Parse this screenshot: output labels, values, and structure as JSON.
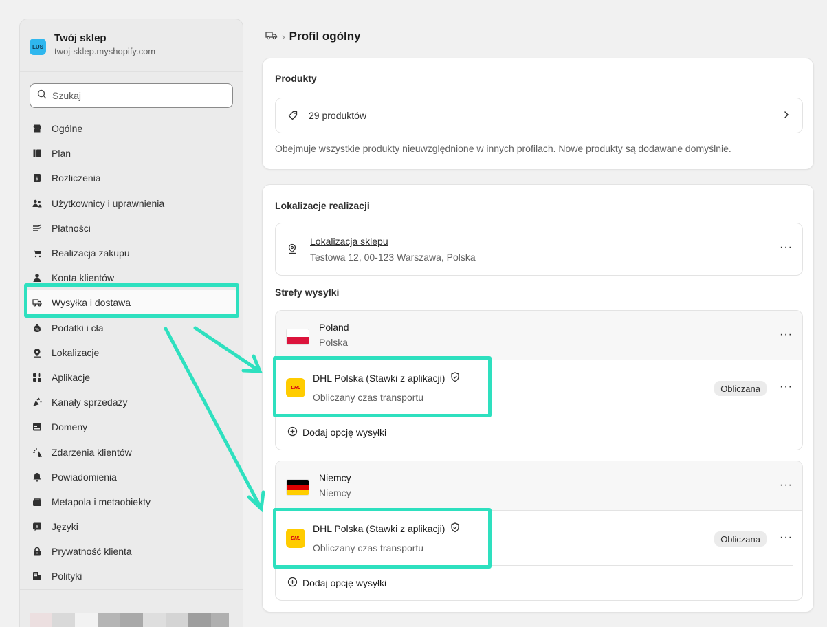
{
  "store": {
    "avatar": "LUS",
    "name": "Twój sklep",
    "url": "twoj-sklep.myshopify.com"
  },
  "search": {
    "placeholder": "Szukaj"
  },
  "nav": [
    {
      "label": "Ogólne",
      "icon": "store-icon"
    },
    {
      "label": "Plan",
      "icon": "plan-icon"
    },
    {
      "label": "Rozliczenia",
      "icon": "billing-icon"
    },
    {
      "label": "Użytkownicy i uprawnienia",
      "icon": "users-icon"
    },
    {
      "label": "Płatności",
      "icon": "payments-icon"
    },
    {
      "label": "Realizacja zakupu",
      "icon": "cart-icon"
    },
    {
      "label": "Konta klientów",
      "icon": "person-icon"
    },
    {
      "label": "Wysyłka i dostawa",
      "icon": "truck-icon",
      "active": true
    },
    {
      "label": "Podatki i cła",
      "icon": "tax-icon"
    },
    {
      "label": "Lokalizacje",
      "icon": "location-icon"
    },
    {
      "label": "Aplikacje",
      "icon": "apps-icon"
    },
    {
      "label": "Kanały sprzedaży",
      "icon": "channels-icon"
    },
    {
      "label": "Domeny",
      "icon": "domains-icon"
    },
    {
      "label": "Zdarzenia klientów",
      "icon": "events-icon"
    },
    {
      "label": "Powiadomienia",
      "icon": "bell-icon"
    },
    {
      "label": "Metapola i metaobiekty",
      "icon": "metafields-icon"
    },
    {
      "label": "Języki",
      "icon": "languages-icon"
    },
    {
      "label": "Prywatność klienta",
      "icon": "lock-icon"
    },
    {
      "label": "Polityki",
      "icon": "policies-icon"
    }
  ],
  "breadcrumb": {
    "separator": "›",
    "title": "Profil ogólny"
  },
  "products": {
    "title": "Produkty",
    "count_label": "29 produktów",
    "description": "Obejmuje wszystkie produkty nieuwzględnione w innych profilach. Nowe produkty są dodawane domyślnie."
  },
  "fulfillment": {
    "title": "Lokalizacje realizacji",
    "location_name": "Lokalizacja sklepu",
    "location_address": "Testowa 12, 00-123 Warszawa, Polska",
    "zones_title": "Strefy wysyłki"
  },
  "zones": [
    {
      "name": "Poland",
      "subtitle": "Polska",
      "flag_colors": [
        "#ffffff",
        "#dc143c"
      ],
      "rate_name": "DHL Polska (Stawki z aplikacji)",
      "rate_sub": "Obliczany czas transportu",
      "badge": "Obliczana",
      "add_label": "Dodaj opcję wysyłki"
    },
    {
      "name": "Niemcy",
      "subtitle": "Niemcy",
      "flag_colors": [
        "#000000",
        "#dd0000",
        "#ffce00"
      ],
      "rate_name": "DHL Polska (Stawki z aplikacji)",
      "rate_sub": "Obliczany czas transportu",
      "badge": "Obliczana",
      "add_label": "Dodaj opcję wysyłki"
    }
  ],
  "dhl_logo": "DHL",
  "more_label": "···",
  "colors": {
    "highlight": "#2ee0bf",
    "avatar": "#2fb7ee",
    "dhl_yellow": "#ffcc00",
    "dhl_red": "#d40511"
  }
}
